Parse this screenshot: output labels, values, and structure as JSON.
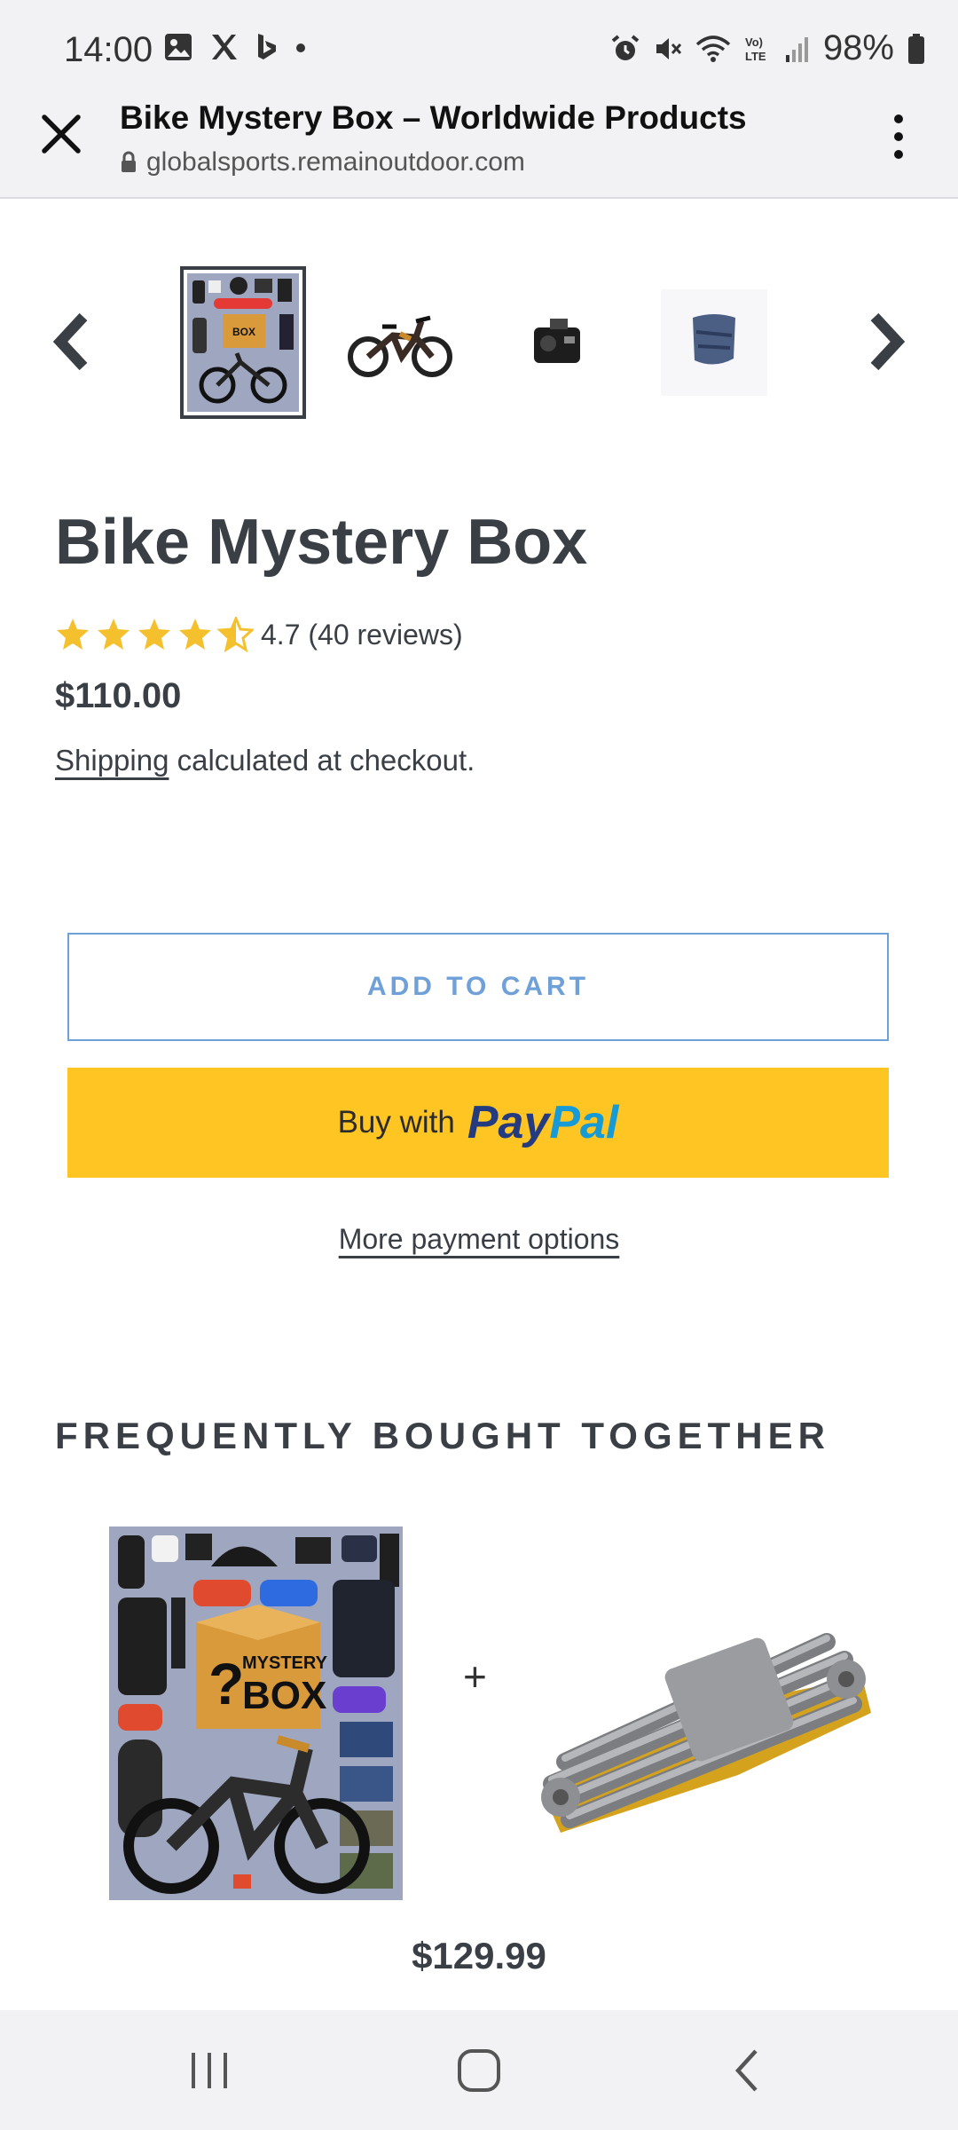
{
  "status_bar": {
    "time": "14:00",
    "battery": "98%",
    "left_icons": [
      "gallery-icon",
      "x-icon",
      "bing-icon",
      "dot-icon"
    ],
    "right_icons": [
      "alarm-icon",
      "mute-icon",
      "wifi-icon",
      "volte-icon",
      "signal-icon",
      "battery-icon"
    ]
  },
  "browser": {
    "title": "Bike Mystery Box – Worldwide Products",
    "url": "globalsports.remainoutdoor.com"
  },
  "gallery": {
    "thumbnails": [
      "mystery-box-collage",
      "mountain-bike",
      "action-camera",
      "neck-gaiter"
    ],
    "active_index": 0
  },
  "product": {
    "title": "Bike Mystery Box",
    "rating_text": "4.7 (40 reviews)",
    "rating": 4.7,
    "price": "$110.00",
    "shipping_link": "Shipping",
    "shipping_rest": " calculated at checkout."
  },
  "actions": {
    "add_to_cart": "ADD TO CART",
    "paypal_prefix": "Buy with",
    "paypal_logo_a": "Pay",
    "paypal_logo_b": "Pal",
    "more_payment": "More payment options"
  },
  "fbt": {
    "title": "FREQUENTLY BOUGHT TOGETHER",
    "plus": "+",
    "price": "$129.99",
    "box_label_1": "MYSTERY",
    "box_label_2": "BOX",
    "box_question": "?"
  },
  "colors": {
    "accent_blue": "#6fa0d8",
    "paypal_yellow": "#ffc522",
    "star": "#f5c02e",
    "text": "#3a3f46"
  }
}
